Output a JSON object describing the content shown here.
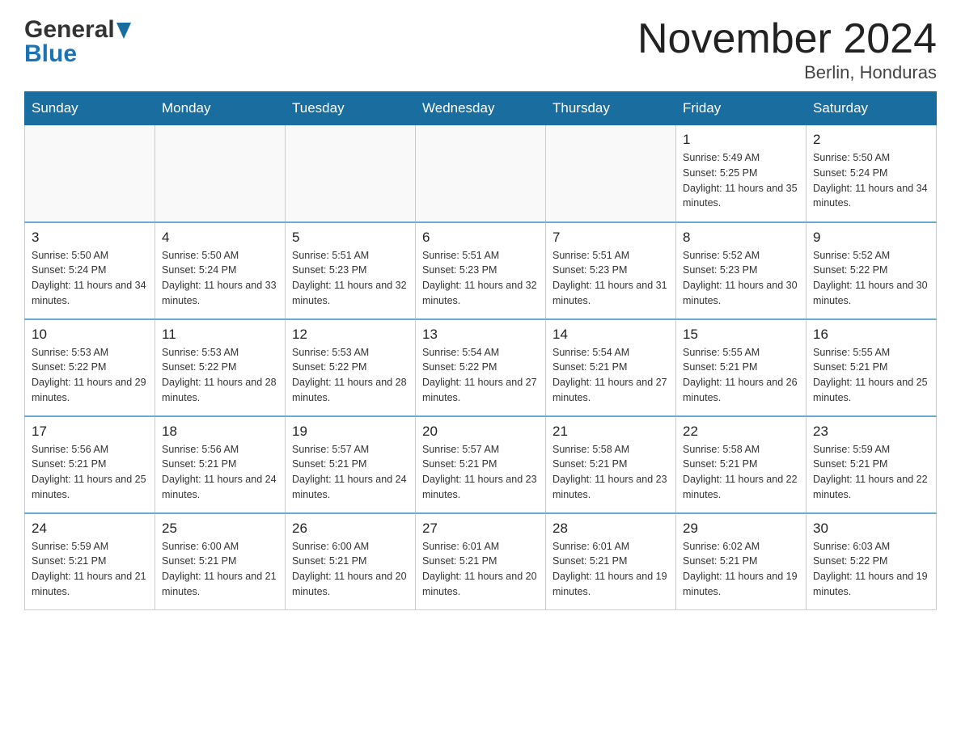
{
  "logo": {
    "general": "General",
    "blue": "Blue"
  },
  "title": "November 2024",
  "subtitle": "Berlin, Honduras",
  "weekdays": [
    "Sunday",
    "Monday",
    "Tuesday",
    "Wednesday",
    "Thursday",
    "Friday",
    "Saturday"
  ],
  "weeks": [
    [
      {
        "day": "",
        "info": ""
      },
      {
        "day": "",
        "info": ""
      },
      {
        "day": "",
        "info": ""
      },
      {
        "day": "",
        "info": ""
      },
      {
        "day": "",
        "info": ""
      },
      {
        "day": "1",
        "info": "Sunrise: 5:49 AM\nSunset: 5:25 PM\nDaylight: 11 hours and 35 minutes."
      },
      {
        "day": "2",
        "info": "Sunrise: 5:50 AM\nSunset: 5:24 PM\nDaylight: 11 hours and 34 minutes."
      }
    ],
    [
      {
        "day": "3",
        "info": "Sunrise: 5:50 AM\nSunset: 5:24 PM\nDaylight: 11 hours and 34 minutes."
      },
      {
        "day": "4",
        "info": "Sunrise: 5:50 AM\nSunset: 5:24 PM\nDaylight: 11 hours and 33 minutes."
      },
      {
        "day": "5",
        "info": "Sunrise: 5:51 AM\nSunset: 5:23 PM\nDaylight: 11 hours and 32 minutes."
      },
      {
        "day": "6",
        "info": "Sunrise: 5:51 AM\nSunset: 5:23 PM\nDaylight: 11 hours and 32 minutes."
      },
      {
        "day": "7",
        "info": "Sunrise: 5:51 AM\nSunset: 5:23 PM\nDaylight: 11 hours and 31 minutes."
      },
      {
        "day": "8",
        "info": "Sunrise: 5:52 AM\nSunset: 5:23 PM\nDaylight: 11 hours and 30 minutes."
      },
      {
        "day": "9",
        "info": "Sunrise: 5:52 AM\nSunset: 5:22 PM\nDaylight: 11 hours and 30 minutes."
      }
    ],
    [
      {
        "day": "10",
        "info": "Sunrise: 5:53 AM\nSunset: 5:22 PM\nDaylight: 11 hours and 29 minutes."
      },
      {
        "day": "11",
        "info": "Sunrise: 5:53 AM\nSunset: 5:22 PM\nDaylight: 11 hours and 28 minutes."
      },
      {
        "day": "12",
        "info": "Sunrise: 5:53 AM\nSunset: 5:22 PM\nDaylight: 11 hours and 28 minutes."
      },
      {
        "day": "13",
        "info": "Sunrise: 5:54 AM\nSunset: 5:22 PM\nDaylight: 11 hours and 27 minutes."
      },
      {
        "day": "14",
        "info": "Sunrise: 5:54 AM\nSunset: 5:21 PM\nDaylight: 11 hours and 27 minutes."
      },
      {
        "day": "15",
        "info": "Sunrise: 5:55 AM\nSunset: 5:21 PM\nDaylight: 11 hours and 26 minutes."
      },
      {
        "day": "16",
        "info": "Sunrise: 5:55 AM\nSunset: 5:21 PM\nDaylight: 11 hours and 25 minutes."
      }
    ],
    [
      {
        "day": "17",
        "info": "Sunrise: 5:56 AM\nSunset: 5:21 PM\nDaylight: 11 hours and 25 minutes."
      },
      {
        "day": "18",
        "info": "Sunrise: 5:56 AM\nSunset: 5:21 PM\nDaylight: 11 hours and 24 minutes."
      },
      {
        "day": "19",
        "info": "Sunrise: 5:57 AM\nSunset: 5:21 PM\nDaylight: 11 hours and 24 minutes."
      },
      {
        "day": "20",
        "info": "Sunrise: 5:57 AM\nSunset: 5:21 PM\nDaylight: 11 hours and 23 minutes."
      },
      {
        "day": "21",
        "info": "Sunrise: 5:58 AM\nSunset: 5:21 PM\nDaylight: 11 hours and 23 minutes."
      },
      {
        "day": "22",
        "info": "Sunrise: 5:58 AM\nSunset: 5:21 PM\nDaylight: 11 hours and 22 minutes."
      },
      {
        "day": "23",
        "info": "Sunrise: 5:59 AM\nSunset: 5:21 PM\nDaylight: 11 hours and 22 minutes."
      }
    ],
    [
      {
        "day": "24",
        "info": "Sunrise: 5:59 AM\nSunset: 5:21 PM\nDaylight: 11 hours and 21 minutes."
      },
      {
        "day": "25",
        "info": "Sunrise: 6:00 AM\nSunset: 5:21 PM\nDaylight: 11 hours and 21 minutes."
      },
      {
        "day": "26",
        "info": "Sunrise: 6:00 AM\nSunset: 5:21 PM\nDaylight: 11 hours and 20 minutes."
      },
      {
        "day": "27",
        "info": "Sunrise: 6:01 AM\nSunset: 5:21 PM\nDaylight: 11 hours and 20 minutes."
      },
      {
        "day": "28",
        "info": "Sunrise: 6:01 AM\nSunset: 5:21 PM\nDaylight: 11 hours and 19 minutes."
      },
      {
        "day": "29",
        "info": "Sunrise: 6:02 AM\nSunset: 5:21 PM\nDaylight: 11 hours and 19 minutes."
      },
      {
        "day": "30",
        "info": "Sunrise: 6:03 AM\nSunset: 5:22 PM\nDaylight: 11 hours and 19 minutes."
      }
    ]
  ]
}
